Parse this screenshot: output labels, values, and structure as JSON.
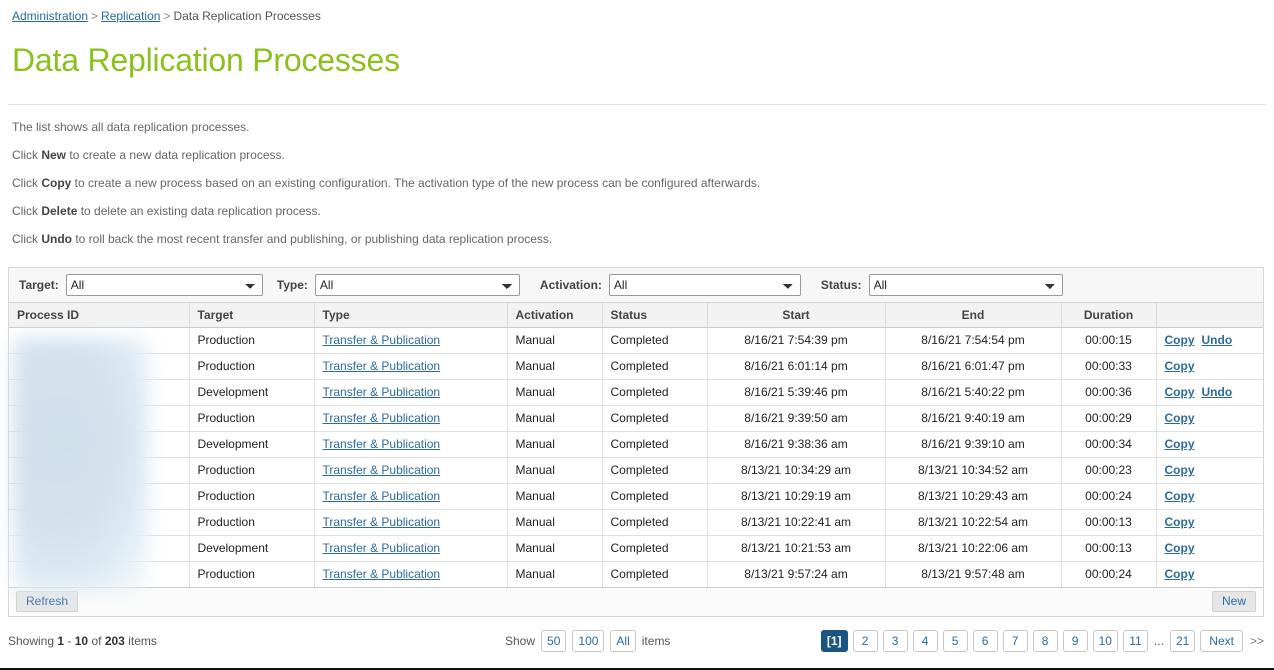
{
  "breadcrumb": {
    "items": [
      {
        "label": "Administration",
        "link": true
      },
      {
        "label": "Replication",
        "link": true
      },
      {
        "label": "Data Replication Processes",
        "link": false
      }
    ],
    "separator": ">"
  },
  "page": {
    "title": "Data Replication Processes",
    "title_color": "#8cc01e"
  },
  "description": {
    "lines": [
      {
        "pre": "The list shows all data replication processes.",
        "bold": "",
        "post": ""
      },
      {
        "pre": "Click ",
        "bold": "New",
        "post": " to create a new data replication process."
      },
      {
        "pre": "Click ",
        "bold": "Copy",
        "post": " to create a new process based on an existing configuration. The activation type of the new process can be configured afterwards."
      },
      {
        "pre": "Click ",
        "bold": "Delete",
        "post": " to delete an existing data replication process."
      },
      {
        "pre": "Click ",
        "bold": "Undo",
        "post": " to roll back the most recent transfer and publishing, or publishing data replication process."
      }
    ]
  },
  "filters": {
    "target": {
      "label": "Target:",
      "value": "All",
      "options": [
        "All",
        "Production",
        "Development"
      ]
    },
    "type": {
      "label": "Type:",
      "value": "All",
      "options": [
        "All",
        "Transfer & Publication"
      ]
    },
    "activation": {
      "label": "Activation:",
      "value": "All",
      "options": [
        "All",
        "Manual"
      ]
    },
    "status": {
      "label": "Status:",
      "value": "All",
      "options": [
        "All",
        "Completed"
      ]
    }
  },
  "table": {
    "headers": [
      "Process ID",
      "Target",
      "Type",
      "Activation",
      "Status",
      "Start",
      "End",
      "Duration",
      ""
    ],
    "process_id_redacted": true,
    "rows": [
      {
        "process_id": "",
        "target": "Production",
        "type": "Transfer & Publication",
        "activation": "Manual",
        "status": "Completed",
        "start": "8/16/21 7:54:39 pm",
        "end": "8/16/21 7:54:54 pm",
        "duration": "00:00:15",
        "actions": [
          "Copy",
          "Undo"
        ]
      },
      {
        "process_id": "",
        "target": "Production",
        "type": "Transfer & Publication",
        "activation": "Manual",
        "status": "Completed",
        "start": "8/16/21 6:01:14 pm",
        "end": "8/16/21 6:01:47 pm",
        "duration": "00:00:33",
        "actions": [
          "Copy"
        ]
      },
      {
        "process_id": "",
        "target": "Development",
        "type": "Transfer & Publication",
        "activation": "Manual",
        "status": "Completed",
        "start": "8/16/21 5:39:46 pm",
        "end": "8/16/21 5:40:22 pm",
        "duration": "00:00:36",
        "actions": [
          "Copy",
          "Undo"
        ]
      },
      {
        "process_id": "",
        "target": "Production",
        "type": "Transfer & Publication",
        "activation": "Manual",
        "status": "Completed",
        "start": "8/16/21 9:39:50 am",
        "end": "8/16/21 9:40:19 am",
        "duration": "00:00:29",
        "actions": [
          "Copy"
        ]
      },
      {
        "process_id": "",
        "target": "Development",
        "type": "Transfer & Publication",
        "activation": "Manual",
        "status": "Completed",
        "start": "8/16/21 9:38:36 am",
        "end": "8/16/21 9:39:10 am",
        "duration": "00:00:34",
        "actions": [
          "Copy"
        ]
      },
      {
        "process_id": "",
        "target": "Production",
        "type": "Transfer & Publication",
        "activation": "Manual",
        "status": "Completed",
        "start": "8/13/21 10:34:29 am",
        "end": "8/13/21 10:34:52 am",
        "duration": "00:00:23",
        "actions": [
          "Copy"
        ]
      },
      {
        "process_id": "",
        "target": "Production",
        "type": "Transfer & Publication",
        "activation": "Manual",
        "status": "Completed",
        "start": "8/13/21 10:29:19 am",
        "end": "8/13/21 10:29:43 am",
        "duration": "00:00:24",
        "actions": [
          "Copy"
        ]
      },
      {
        "process_id": "",
        "target": "Production",
        "type": "Transfer & Publication",
        "activation": "Manual",
        "status": "Completed",
        "start": "8/13/21 10:22:41 am",
        "end": "8/13/21 10:22:54 am",
        "duration": "00:00:13",
        "actions": [
          "Copy"
        ]
      },
      {
        "process_id": "",
        "target": "Development",
        "type": "Transfer & Publication",
        "activation": "Manual",
        "status": "Completed",
        "start": "8/13/21 10:21:53 am",
        "end": "8/13/21 10:22:06 am",
        "duration": "00:00:13",
        "actions": [
          "Copy"
        ]
      },
      {
        "process_id": "",
        "target": "Production",
        "type": "Transfer & Publication",
        "activation": "Manual",
        "status": "Completed",
        "start": "8/13/21 9:57:24 am",
        "end": "8/13/21 9:57:48 am",
        "duration": "00:00:24",
        "actions": [
          "Copy"
        ]
      }
    ]
  },
  "toolbar": {
    "refresh_label": "Refresh",
    "new_label": "New"
  },
  "footer": {
    "showing_prefix": "Showing",
    "showing_from": "1",
    "showing_dash": "-",
    "showing_to": "10",
    "showing_of": "of",
    "showing_total": "203",
    "showing_suffix": "items",
    "show_label": "Show",
    "page_sizes": [
      "50",
      "100",
      "All"
    ],
    "items_label": "items",
    "pages": [
      "[1]",
      "2",
      "3",
      "4",
      "5",
      "6",
      "7",
      "8",
      "9",
      "10",
      "11"
    ],
    "active_page": "[1]",
    "ellipsis": "...",
    "last_page": "21",
    "next_label": "Next",
    "forward_label": ">>"
  },
  "colors": {
    "link": "#2c6b9e",
    "title_green": "#8cc01e",
    "active_page_bg": "#1b5582"
  }
}
